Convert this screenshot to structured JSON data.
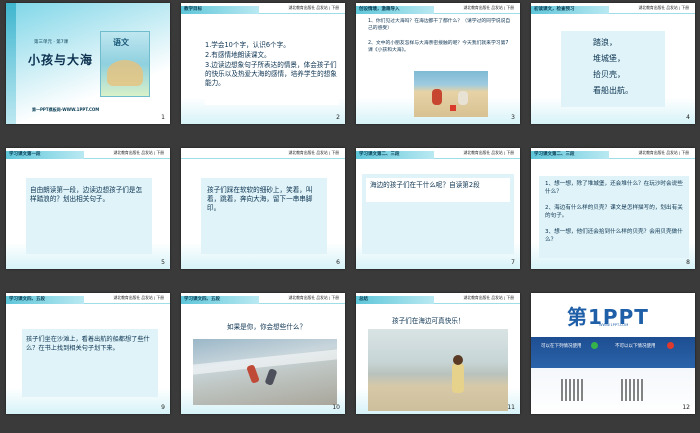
{
  "header": {
    "publisher": "湖北教育出版社  品发站 | 下册"
  },
  "slides": [
    {
      "num": "1",
      "unit": "第三单元 · 第7课",
      "title": "小孩与大海",
      "book": "语文",
      "footer": "第一PPT模板网-WWW.1PPT.COM"
    },
    {
      "num": "2",
      "section": "教学目标",
      "items": [
        "1.学会10个字，认识6个字。",
        "2.有感情地朗读课文。",
        "3.边读边想象句子所表达的情景，体会孩子们的快乐以及热爱大海的感情，培养学生的想象能力。"
      ]
    },
    {
      "num": "3",
      "section": "创设情境，激趣导入",
      "items": [
        "1、你们见过大海吗？在海边都干了都什么？（请学过的同学说说自己的感受）",
        "2、文中的小朋友怎样与大海亲密接触的呢？今天我们就来学习第7课《小孩和大海》。"
      ]
    },
    {
      "num": "4",
      "section": "初读课文，检查预习",
      "words": [
        "踏浪，",
        "堆城堡，",
        "拾贝壳，",
        "看船出航。"
      ]
    },
    {
      "num": "5",
      "section": "学习课文第一段",
      "text": "自由朗读第一段，边读边想孩子们是怎样踏浪的？划出相关句子。"
    },
    {
      "num": "6",
      "text": "孩子们踩在软软的细砂上，笑着，叫着，跳着，奔向大海，留下一串串脚印。"
    },
    {
      "num": "7",
      "section": "学习课文第二、三段",
      "text": "海边的孩子们在干什么呢？自读第2段"
    },
    {
      "num": "8",
      "section": "学习课文第二、三段",
      "items": [
        "1、想一想，除了堆城堡，还会堆什么？在玩沙时会说些什么？",
        "2、海边有什么样的贝壳？课文是怎样描写的，划出有关的句子。",
        "3、想一想，他们还会拾到什么样的贝壳？会用贝壳做什么？"
      ]
    },
    {
      "num": "9",
      "section": "学习课文四、五段",
      "text": "孩子们坐在沙滩上，看着出航的船都想了些什么？在书上找到相关句子划下来。"
    },
    {
      "num": "10",
      "section": "学习课文四、五段",
      "text": "如果是你，你会想些什么？"
    },
    {
      "num": "11",
      "section": "总结",
      "text": "孩子们在海边可真快乐！"
    },
    {
      "num": "12",
      "logo": "第1PPT",
      "logo_url": "WWW.1PPT.COM",
      "left_title": "可以在下列情况使用",
      "right_title": "不可以以下情况使用"
    }
  ],
  "colors": {
    "accent": "#5ec6d9",
    "text": "#0b3250",
    "background": "#3a3a3a"
  }
}
